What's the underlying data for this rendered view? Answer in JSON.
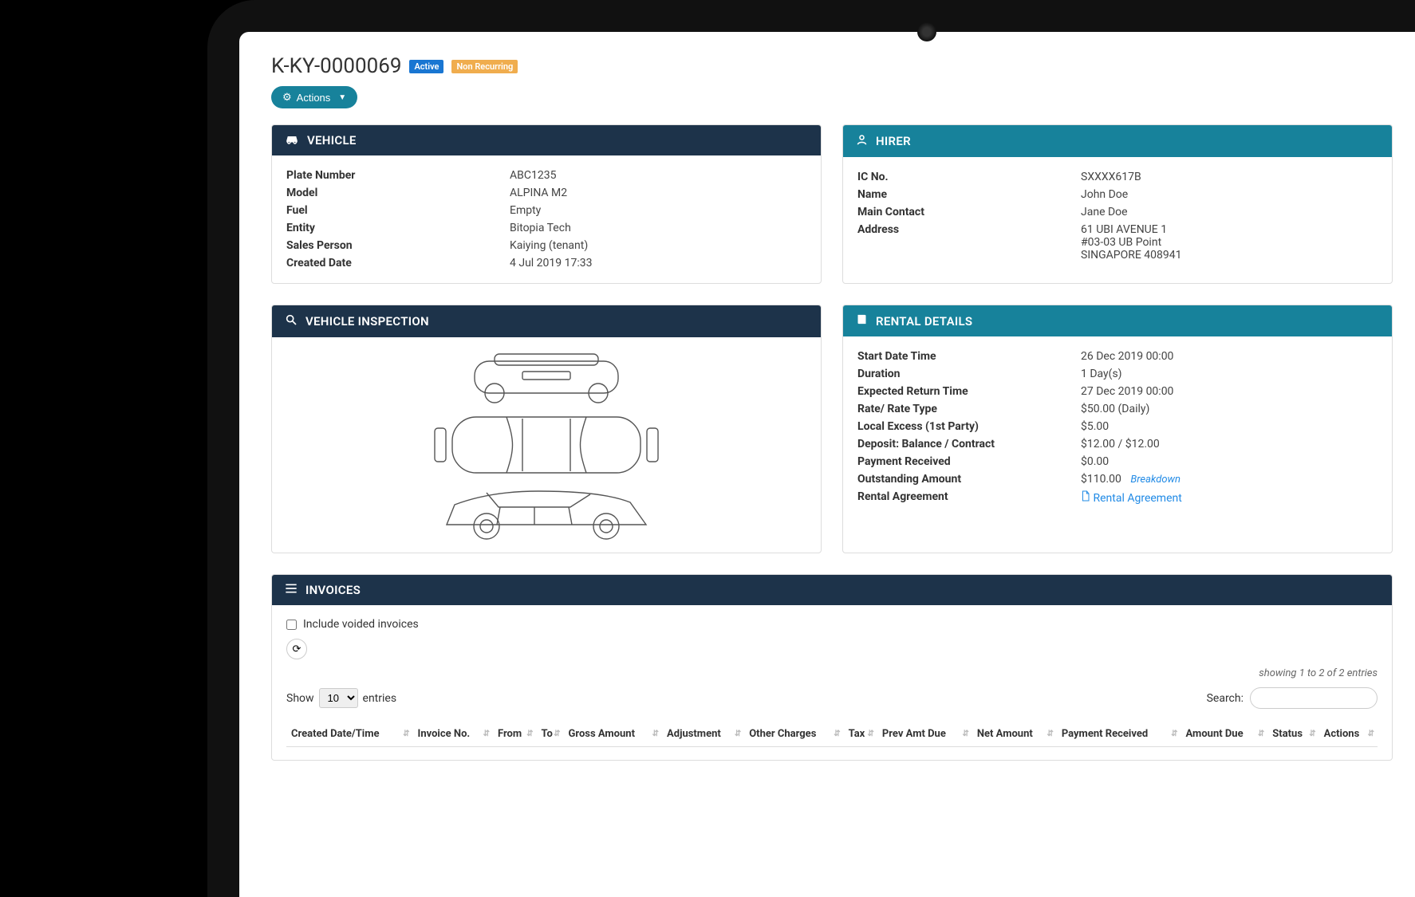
{
  "header": {
    "title": "K-KY-0000069",
    "badge_active": "Active",
    "badge_nonrec": "Non Recurring",
    "actions_label": "Actions"
  },
  "vehicle": {
    "panel_title": "VEHICLE",
    "rows": [
      {
        "label": "Plate Number",
        "value": "ABC1235"
      },
      {
        "label": "Model",
        "value": "ALPINA M2"
      },
      {
        "label": "Fuel",
        "value": "Empty"
      },
      {
        "label": "Entity",
        "value": "Bitopia Tech"
      },
      {
        "label": "Sales Person",
        "value": "Kaiying (tenant)"
      },
      {
        "label": "Created Date",
        "value": "4 Jul 2019 17:33"
      }
    ]
  },
  "hirer": {
    "panel_title": "HIRER",
    "rows": [
      {
        "label": "IC No.",
        "value": "SXXXX617B"
      },
      {
        "label": "Name",
        "value": "John Doe"
      },
      {
        "label": "Main Contact",
        "value": "Jane Doe"
      }
    ],
    "address_label": "Address",
    "address_lines": [
      "61 UBI AVENUE 1",
      "#03-03 UB Point",
      "SINGAPORE 408941"
    ]
  },
  "inspection": {
    "panel_title": "VEHICLE INSPECTION"
  },
  "rental": {
    "panel_title": "RENTAL DETAILS",
    "rows": [
      {
        "label": "Start Date Time",
        "value": "26 Dec 2019 00:00"
      },
      {
        "label": "Duration",
        "value": "1 Day(s)"
      },
      {
        "label": "Expected Return Time",
        "value": "27 Dec 2019 00:00"
      },
      {
        "label": "Rate/ Rate Type",
        "value": "$50.00 (Daily)"
      },
      {
        "label": "Local Excess (1st Party)",
        "value": "$5.00"
      },
      {
        "label": "Deposit: Balance / Contract",
        "value": "$12.00 / $12.00"
      },
      {
        "label": "Payment Received",
        "value": "$0.00"
      }
    ],
    "outstanding_label": "Outstanding Amount",
    "outstanding_value": "$110.00",
    "breakdown_link": "Breakdown",
    "agreement_label": "Rental Agreement",
    "agreement_link": "Rental Agreement"
  },
  "invoices": {
    "panel_title": "INVOICES",
    "include_voided_label": "Include voided invoices",
    "showing_text": "showing 1 to 2 of 2 entries",
    "show_label": "Show",
    "entries_label": "entries",
    "page_size": "10",
    "search_label": "Search:",
    "columns": [
      "Created Date/Time",
      "Invoice No.",
      "From",
      "To",
      "Gross Amount",
      "Adjustment",
      "Other Charges",
      "Tax",
      "Prev Amt Due",
      "Net Amount",
      "Payment Received",
      "Amount Due",
      "Status",
      "Actions"
    ]
  }
}
